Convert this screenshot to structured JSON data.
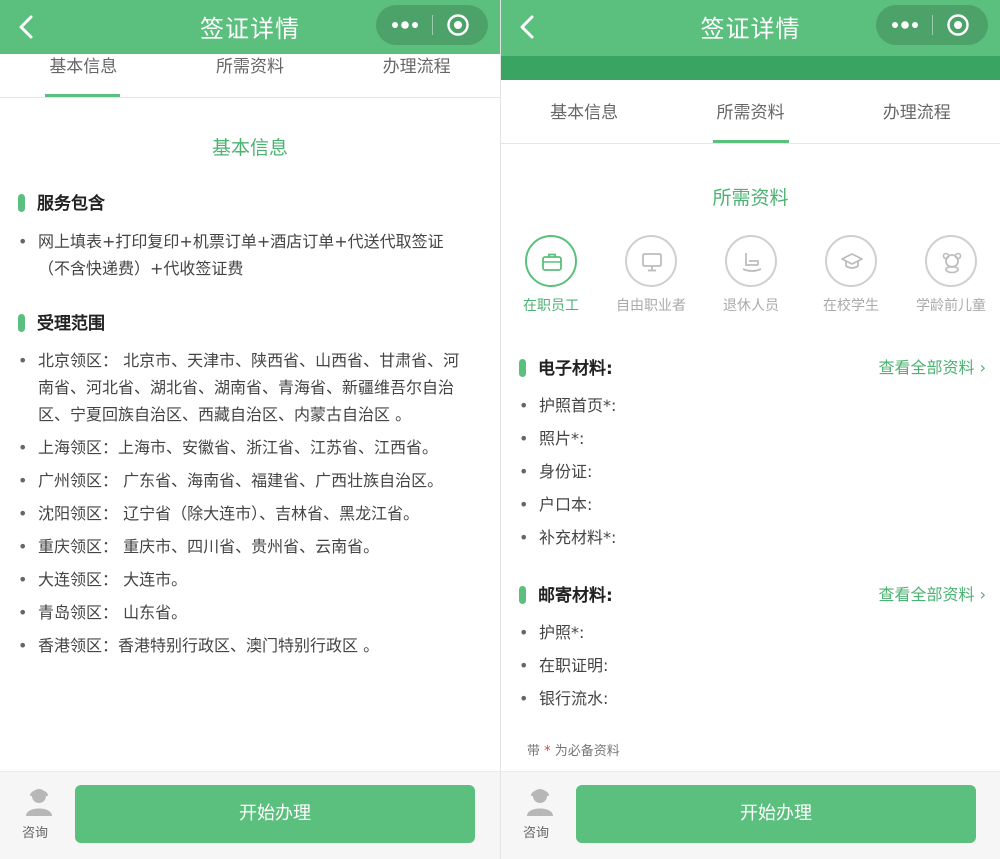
{
  "nav": {
    "title": "签证详情",
    "more_glyph": "•••"
  },
  "tabs": [
    "基本信息",
    "所需资料",
    "办理流程"
  ],
  "left": {
    "section_title": "基本信息",
    "service": {
      "heading": "服务包含",
      "items": [
        "网上填表+打印复印+机票订单+酒店订单+代送代取签证（不含快递费）+代收签证费"
      ]
    },
    "scope": {
      "heading": "受理范围",
      "items": [
        "北京领区： 北京市、天津市、陕西省、山西省、甘肃省、河南省、河北省、湖北省、湖南省、青海省、新疆维吾尔自治区、宁夏回族自治区、西藏自治区、内蒙古自治区 。",
        "上海领区：上海市、安徽省、浙江省、江苏省、江西省。",
        "广州领区： 广东省、海南省、福建省、广西壮族自治区。",
        "沈阳领区： 辽宁省（除大连市）、吉林省、黑龙江省。",
        "重庆领区： 重庆市、四川省、贵州省、云南省。",
        "大连领区： 大连市。",
        "青岛领区： 山东省。",
        "香港领区：香港特别行政区、澳门特别行政区 。"
      ]
    }
  },
  "right": {
    "section_title": "所需资料",
    "categories": [
      {
        "label": "在职员工",
        "icon": "briefcase-icon",
        "active": true
      },
      {
        "label": "自由职业者",
        "icon": "monitor-icon",
        "active": false
      },
      {
        "label": "退休人员",
        "icon": "rocking-chair-icon",
        "active": false
      },
      {
        "label": "在校学生",
        "icon": "graduation-cap-icon",
        "active": false
      },
      {
        "label": "学龄前儿童",
        "icon": "teddy-bear-icon",
        "active": false
      }
    ],
    "electronic": {
      "heading": "电子材料:",
      "see_all": "查看全部资料 ›",
      "items": [
        "护照首页*:",
        "照片*:",
        "身份证:",
        "户口本:",
        "补充材料*:"
      ]
    },
    "mail": {
      "heading": "邮寄材料:",
      "see_all": "查看全部资料 ›",
      "items": [
        "护照*:",
        "在职证明:",
        "银行流水:"
      ]
    },
    "footnote": {
      "prefix": "带",
      "star": "*",
      "suffix": "为必备资料"
    }
  },
  "bottom": {
    "consult_label": "咨询",
    "start_label": "开始办理"
  },
  "colors": {
    "accent": "#5bbf7d",
    "accent_dark": "#3aa563",
    "required": "#e04040"
  }
}
